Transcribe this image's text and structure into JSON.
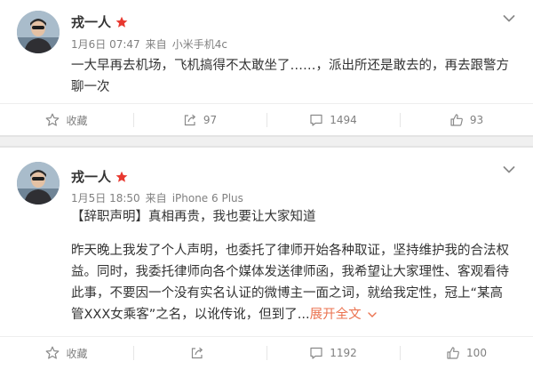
{
  "posts": [
    {
      "author": "戎一人",
      "meta": {
        "date": "1月6日 07:47",
        "via": "来自",
        "device": "小米手机4c"
      },
      "text": "一大早再去机场，飞机搞得不太敢坐了……，派出所还是敢去的，再去跟警方聊一次",
      "actions": {
        "favorite": "收藏",
        "repost": "97",
        "comment": "1494",
        "like": "93"
      }
    },
    {
      "author": "戎一人",
      "meta": {
        "date": "1月5日 18:50",
        "via": "来自",
        "device": "iPhone 6 Plus"
      },
      "headline": "【辞职声明】真相再贵，我也要让大家知道",
      "body": "昨天晚上我发了个人声明，也委托了律师开始各种取证，坚持维护我的合法权益。同时，我委托律师向各个媒体发送律师函，我希望让大家理性、客观看待此事，不要因一个没有实名认证的微博主一面之词，就给我定性，冠上“某高管XXX女乘客”之名，以讹传讹，但到了...",
      "expand_label": "展开全文",
      "actions": {
        "favorite": "收藏",
        "repost": "",
        "comment": "1192",
        "like": "100"
      }
    }
  ],
  "colors": {
    "accent": "#eb7350",
    "meta": "#808080",
    "text": "#333333",
    "badge": "#e8382f"
  },
  "icons": [
    "avatar-photo",
    "vip-star-icon",
    "chevron-down-icon",
    "star-icon",
    "share-icon",
    "comment-icon",
    "thumb-up-icon"
  ]
}
